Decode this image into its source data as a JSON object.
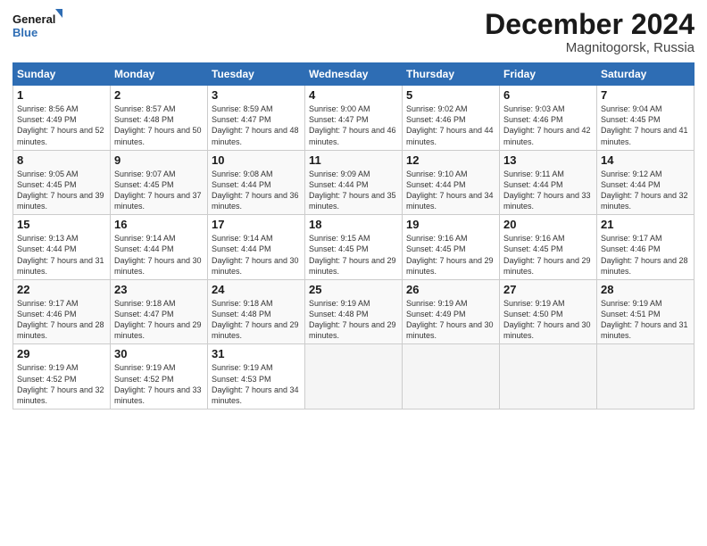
{
  "header": {
    "logo_text_general": "General",
    "logo_text_blue": "Blue",
    "title": "December 2024",
    "location": "Magnitogorsk, Russia"
  },
  "days_of_week": [
    "Sunday",
    "Monday",
    "Tuesday",
    "Wednesday",
    "Thursday",
    "Friday",
    "Saturday"
  ],
  "weeks": [
    [
      {
        "num": "1",
        "sunrise": "8:56 AM",
        "sunset": "4:49 PM",
        "daylight": "7 hours and 52 minutes."
      },
      {
        "num": "2",
        "sunrise": "8:57 AM",
        "sunset": "4:48 PM",
        "daylight": "7 hours and 50 minutes."
      },
      {
        "num": "3",
        "sunrise": "8:59 AM",
        "sunset": "4:47 PM",
        "daylight": "7 hours and 48 minutes."
      },
      {
        "num": "4",
        "sunrise": "9:00 AM",
        "sunset": "4:47 PM",
        "daylight": "7 hours and 46 minutes."
      },
      {
        "num": "5",
        "sunrise": "9:02 AM",
        "sunset": "4:46 PM",
        "daylight": "7 hours and 44 minutes."
      },
      {
        "num": "6",
        "sunrise": "9:03 AM",
        "sunset": "4:46 PM",
        "daylight": "7 hours and 42 minutes."
      },
      {
        "num": "7",
        "sunrise": "9:04 AM",
        "sunset": "4:45 PM",
        "daylight": "7 hours and 41 minutes."
      }
    ],
    [
      {
        "num": "8",
        "sunrise": "9:05 AM",
        "sunset": "4:45 PM",
        "daylight": "7 hours and 39 minutes."
      },
      {
        "num": "9",
        "sunrise": "9:07 AM",
        "sunset": "4:45 PM",
        "daylight": "7 hours and 37 minutes."
      },
      {
        "num": "10",
        "sunrise": "9:08 AM",
        "sunset": "4:44 PM",
        "daylight": "7 hours and 36 minutes."
      },
      {
        "num": "11",
        "sunrise": "9:09 AM",
        "sunset": "4:44 PM",
        "daylight": "7 hours and 35 minutes."
      },
      {
        "num": "12",
        "sunrise": "9:10 AM",
        "sunset": "4:44 PM",
        "daylight": "7 hours and 34 minutes."
      },
      {
        "num": "13",
        "sunrise": "9:11 AM",
        "sunset": "4:44 PM",
        "daylight": "7 hours and 33 minutes."
      },
      {
        "num": "14",
        "sunrise": "9:12 AM",
        "sunset": "4:44 PM",
        "daylight": "7 hours and 32 minutes."
      }
    ],
    [
      {
        "num": "15",
        "sunrise": "9:13 AM",
        "sunset": "4:44 PM",
        "daylight": "7 hours and 31 minutes."
      },
      {
        "num": "16",
        "sunrise": "9:14 AM",
        "sunset": "4:44 PM",
        "daylight": "7 hours and 30 minutes."
      },
      {
        "num": "17",
        "sunrise": "9:14 AM",
        "sunset": "4:44 PM",
        "daylight": "7 hours and 30 minutes."
      },
      {
        "num": "18",
        "sunrise": "9:15 AM",
        "sunset": "4:45 PM",
        "daylight": "7 hours and 29 minutes."
      },
      {
        "num": "19",
        "sunrise": "9:16 AM",
        "sunset": "4:45 PM",
        "daylight": "7 hours and 29 minutes."
      },
      {
        "num": "20",
        "sunrise": "9:16 AM",
        "sunset": "4:45 PM",
        "daylight": "7 hours and 29 minutes."
      },
      {
        "num": "21",
        "sunrise": "9:17 AM",
        "sunset": "4:46 PM",
        "daylight": "7 hours and 28 minutes."
      }
    ],
    [
      {
        "num": "22",
        "sunrise": "9:17 AM",
        "sunset": "4:46 PM",
        "daylight": "7 hours and 28 minutes."
      },
      {
        "num": "23",
        "sunrise": "9:18 AM",
        "sunset": "4:47 PM",
        "daylight": "7 hours and 29 minutes."
      },
      {
        "num": "24",
        "sunrise": "9:18 AM",
        "sunset": "4:48 PM",
        "daylight": "7 hours and 29 minutes."
      },
      {
        "num": "25",
        "sunrise": "9:19 AM",
        "sunset": "4:48 PM",
        "daylight": "7 hours and 29 minutes."
      },
      {
        "num": "26",
        "sunrise": "9:19 AM",
        "sunset": "4:49 PM",
        "daylight": "7 hours and 30 minutes."
      },
      {
        "num": "27",
        "sunrise": "9:19 AM",
        "sunset": "4:50 PM",
        "daylight": "7 hours and 30 minutes."
      },
      {
        "num": "28",
        "sunrise": "9:19 AM",
        "sunset": "4:51 PM",
        "daylight": "7 hours and 31 minutes."
      }
    ],
    [
      {
        "num": "29",
        "sunrise": "9:19 AM",
        "sunset": "4:52 PM",
        "daylight": "7 hours and 32 minutes."
      },
      {
        "num": "30",
        "sunrise": "9:19 AM",
        "sunset": "4:52 PM",
        "daylight": "7 hours and 33 minutes."
      },
      {
        "num": "31",
        "sunrise": "9:19 AM",
        "sunset": "4:53 PM",
        "daylight": "7 hours and 34 minutes."
      },
      null,
      null,
      null,
      null
    ]
  ]
}
